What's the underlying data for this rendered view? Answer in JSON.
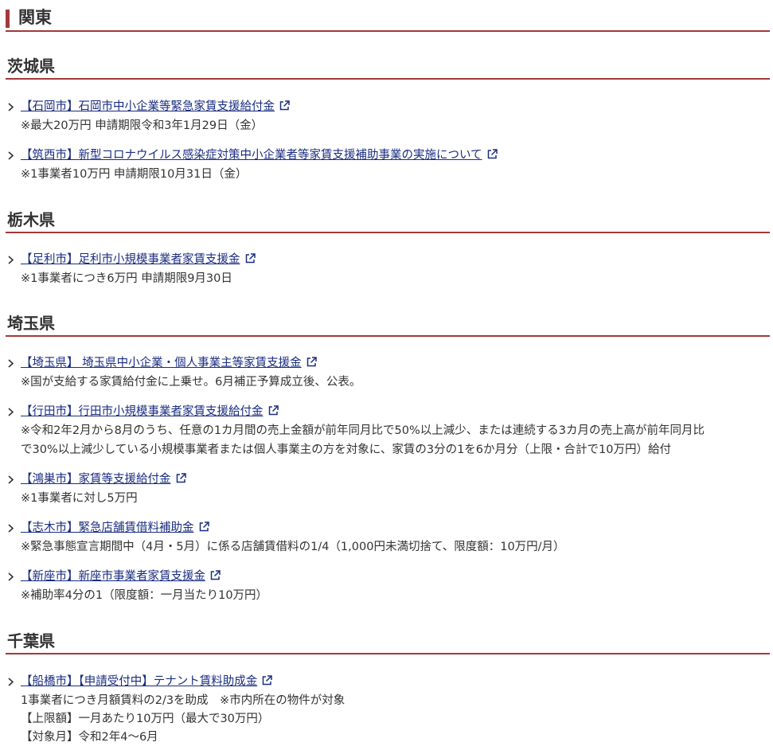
{
  "region": {
    "title": "関東"
  },
  "sections": {
    "ibaraki": {
      "title": "茨城県",
      "items": [
        {
          "link": "【石岡市】石岡市中小企業等緊急家賃支援給付金",
          "notes": [
            "※最大20万円 申請期限令和3年1月29日（金）"
          ]
        },
        {
          "link": "【筑西市】新型コロナウイルス感染症対策中小企業者等家賃支援補助事業の実施について",
          "notes": [
            "※1事業者10万円 申請期限10月31日（金）"
          ]
        }
      ]
    },
    "tochigi": {
      "title": "栃木県",
      "items": [
        {
          "link": "【足利市】足利市小規模事業者家賃支援金",
          "notes": [
            "※1事業者につき6万円 申請期限9月30日"
          ]
        }
      ]
    },
    "saitama": {
      "title": "埼玉県",
      "items": [
        {
          "link": "【埼玉県】 埼玉県中小企業・個人事業主等家賃支援金",
          "notes": [
            "※国が支給する家賃給付金に上乗せ。6月補正予算成立後、公表。"
          ]
        },
        {
          "link": "【行田市】行田市小規模事業者家賃支援給付金",
          "notes": [
            "※令和2年2月から8月のうち、任意の1カ月間の売上金額が前年同月比で50%以上減少、または連続する3カ月の売上高が前年同月比",
            "で30%以上減少している小規模事業者または個人事業主の方を対象に、家賃の3分の1を6か月分（上限・合計で10万円）給付"
          ]
        },
        {
          "link": "【鴻巣市】家賃等支援給付金",
          "notes": [
            "※1事業者に対し5万円"
          ]
        },
        {
          "link": "【志木市】緊急店舗賃借料補助金",
          "notes": [
            "※緊急事態宣言期間中（4月・5月）に係る店舗賃借料の1/4（1,000円未満切捨て、限度額：10万円/月）"
          ]
        },
        {
          "link": "【新座市】新座市事業者家賃支援金",
          "notes": [
            "※補助率4分の1（限度額：一月当たり10万円）"
          ]
        }
      ]
    },
    "chiba": {
      "title": "千葉県",
      "items": [
        {
          "link": "【船橋市】【申請受付中】テナント賃料助成金",
          "notes": [
            "1事業者につき月額賃料の2/3を助成　※市内所在の物件が対象",
            "【上限額】一月あたり10万円（最大で30万円）",
            "【対象月】令和2年4～6月"
          ]
        }
      ]
    }
  }
}
